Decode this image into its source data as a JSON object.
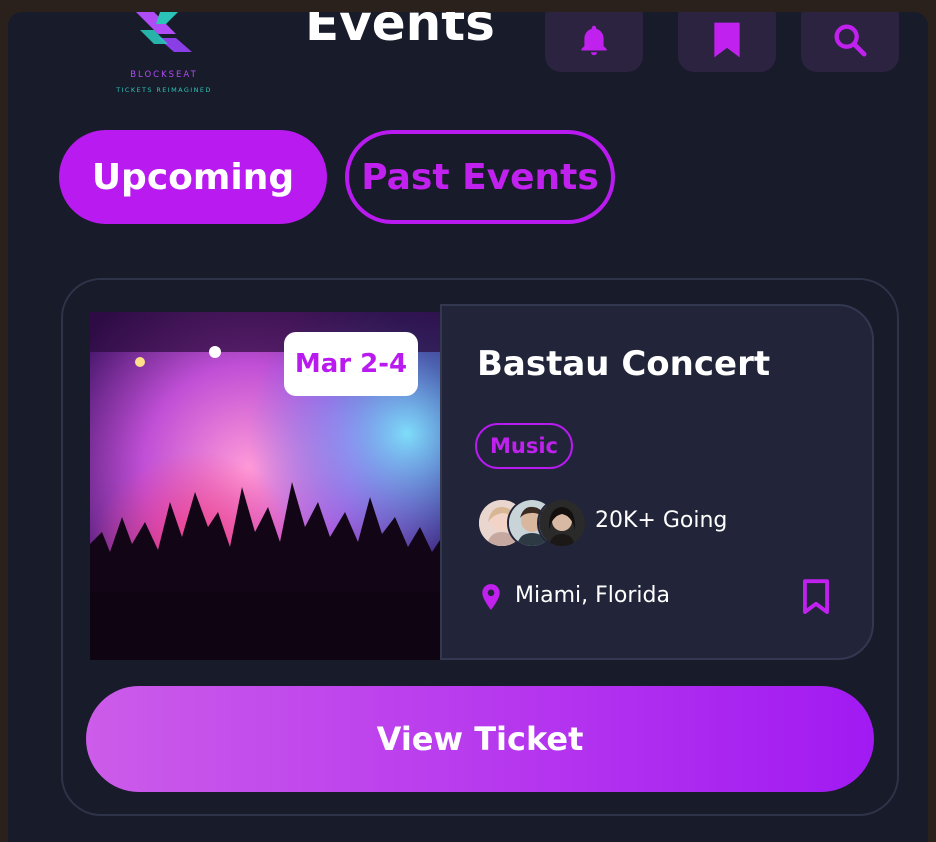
{
  "brand": {
    "name": "BLOCKSEAT",
    "tagline": "TICKETS REIMAGINED"
  },
  "header": {
    "title": "Events",
    "icons": [
      "bell-icon",
      "bookmark-icon",
      "search-icon"
    ]
  },
  "tabs": [
    {
      "label": "Upcoming",
      "active": true
    },
    {
      "label": "Past Events",
      "active": false
    }
  ],
  "event": {
    "date": "Mar 2-4",
    "title": "Bastau Concert",
    "category": "Music",
    "attendees": "20K+ Going",
    "location": "Miami, Florida",
    "action_label": "View Ticket"
  },
  "colors": {
    "accent": "#b81af0",
    "background": "#181b29",
    "panel": "#22253a",
    "icon_button": "#2b2340"
  }
}
